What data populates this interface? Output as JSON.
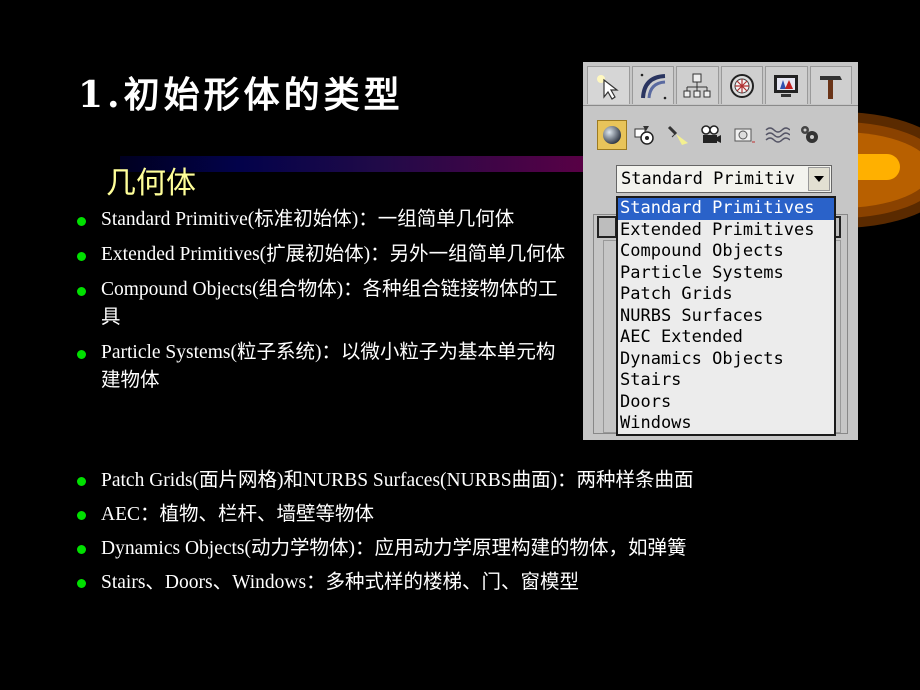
{
  "slide": {
    "title": "1.初始形体的类型",
    "subtitle": "几何体",
    "bullets_top": [
      {
        "text": "Standard Primitive(标准初始体)：一组简单几何体"
      },
      {
        "text": "Extended Primitives(扩展初始体)：另外一组简单几何体"
      },
      {
        "text": "Compound Objects(组合物体)：各种组合链接物体的工具"
      },
      {
        "text": "Particle Systems(粒子系统)：以微小粒子为基本单元构建物体"
      }
    ],
    "bullets_bottom": [
      {
        "text": "Patch Grids(面片网格)和NURBS  Surfaces(NURBS曲面)：两种样条曲面"
      },
      {
        "text": "AEC：植物、栏杆、墙壁等物体"
      },
      {
        "text": "Dynamics Objects(动力学物体)：应用动力学原理构建的物体，如弹簧"
      },
      {
        "text": "Stairs、Doors、Windows：多种式样的楼梯、门、窗模型"
      }
    ],
    "colors": {
      "background": "#000000",
      "title": "#ffffff",
      "subtitle": "#ffff99",
      "bullet_dot": "#00e000",
      "selection": "#2a62c9"
    }
  },
  "panel": {
    "tabs": [
      {
        "name": "create",
        "icon": "cursor-star-icon"
      },
      {
        "name": "modify",
        "icon": "modify-arc-icon"
      },
      {
        "name": "hierarchy",
        "icon": "hierarchy-icon"
      },
      {
        "name": "motion",
        "icon": "motion-wheel-icon"
      },
      {
        "name": "display",
        "icon": "display-monitor-icon"
      },
      {
        "name": "utilities",
        "icon": "hammer-icon"
      }
    ],
    "subcategories": [
      {
        "name": "geometry",
        "icon": "sphere-icon",
        "active": true
      },
      {
        "name": "shapes",
        "icon": "shapes-icon"
      },
      {
        "name": "lights",
        "icon": "light-icon"
      },
      {
        "name": "cameras",
        "icon": "camera-icon"
      },
      {
        "name": "helpers",
        "icon": "helper-icon"
      },
      {
        "name": "space-warps",
        "icon": "wave-icon"
      },
      {
        "name": "systems",
        "icon": "gears-icon"
      }
    ],
    "combo_value": "Standard Primitiv",
    "options": [
      "Standard Primitives",
      "Extended Primitives",
      "Compound Objects",
      "Particle Systems",
      "Patch Grids",
      "NURBS Surfaces",
      "AEC Extended",
      "Dynamics Objects",
      "Stairs",
      "Doors",
      "Windows"
    ],
    "selected_index": 0
  }
}
